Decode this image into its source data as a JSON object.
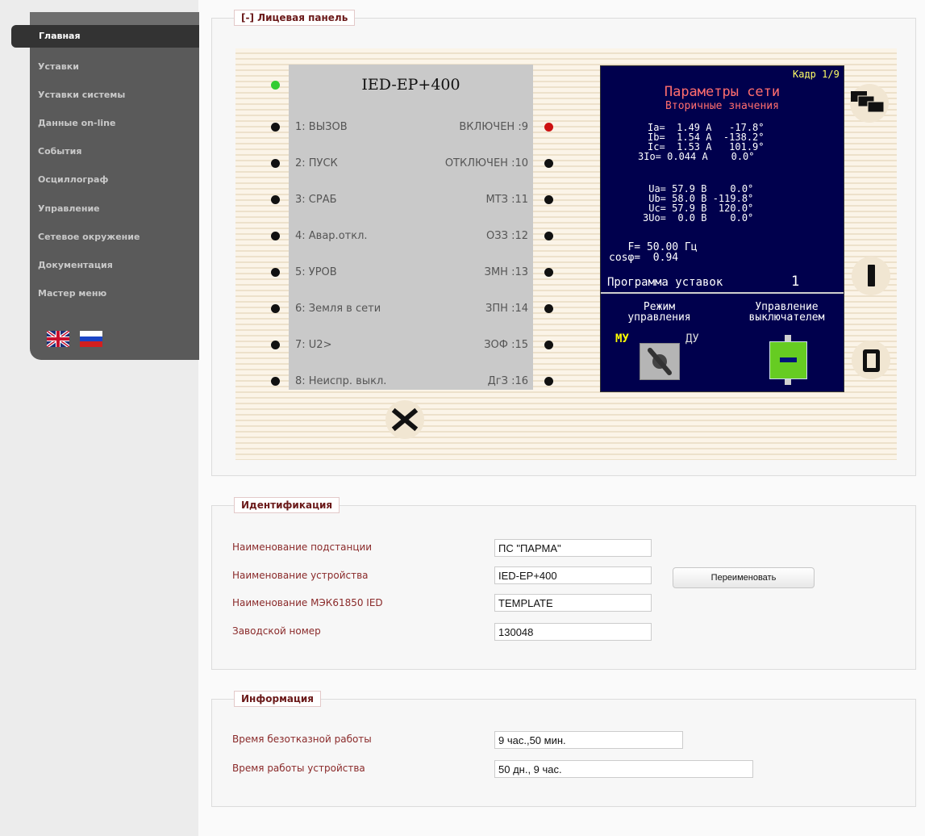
{
  "sidebar": {
    "items": [
      {
        "label": "Главная",
        "active": true
      },
      {
        "label": "Уставки"
      },
      {
        "label": "Уставки системы"
      },
      {
        "label": "Данные on-line"
      },
      {
        "label": "События"
      },
      {
        "label": "Осциллограф"
      },
      {
        "label": "Управление"
      },
      {
        "label": "Сетевое окружение"
      },
      {
        "label": "Документация"
      },
      {
        "label": "Мастер меню"
      }
    ],
    "languages": [
      "english-flag",
      "russian-flag"
    ]
  },
  "face_panel": {
    "legend": "[-] Лицевая панель",
    "device_title": "IED-EP+400",
    "left_leds": [
      "1: ВЫЗОВ",
      "2: ПУСК",
      "3: СРАБ",
      "4: Авар.откл.",
      "5: УРОВ",
      "6: Земля в сети",
      "7: U2>",
      "8: Неиспр. выкл."
    ],
    "right_leds": [
      "ВКЛЮЧЕН :9",
      "ОТКЛЮЧЕН :10",
      "МТЗ :11",
      "ОЗЗ :12",
      "ЗМН :13",
      "ЗПН :14",
      "ЗОФ :15",
      "ДгЗ :16"
    ],
    "colors": {
      "led_green": "#33cc33",
      "led_red": "#cc1111",
      "led_off": "#111111",
      "screen_bg": "#00004d",
      "title_red": "#ff6d6d",
      "mode_yellow": "#ffff00",
      "switch_green": "#66cc22"
    },
    "screen": {
      "frame": "Кадр 1/9",
      "title": "Параметры сети",
      "subtitle": "Вторичные значения",
      "currents": [
        "Ia=  1.49 A   -17.8°",
        "Ib=  1.54 A  -138.2°",
        "Ic=  1.53 A   101.9°",
        "3Io= 0.044 A    0.0°"
      ],
      "voltages": [
        " Ua= 57.9 B    0.0°",
        " Ub= 58.0 B -119.8°",
        " Uc= 57.9 B  120.0°",
        "3Uo=  0.0 B    0.0°"
      ],
      "freq": "   F= 50.00 Гц",
      "cos": "cosφ=  0.94",
      "program_label": "Программа уставок",
      "program_value": "1",
      "mode_label": "Режим\nуправления",
      "switch_label": "Управление\nвыключателем",
      "mode_local": "МУ",
      "mode_remote": "ДУ"
    },
    "buttons": {
      "close": "x",
      "one": "I",
      "zero": "O",
      "pages": "pages-icon"
    }
  },
  "identification": {
    "legend": "Идентификация",
    "rows": [
      {
        "label": "Наименование подстанции",
        "value": "ПС \"ПАРМА\""
      },
      {
        "label": "Наименование устройства",
        "value": "IED-EP+400"
      },
      {
        "label": "Наименование МЭК61850 IED",
        "value": "TEMPLATE"
      },
      {
        "label": "Заводской номер",
        "value": "130048"
      }
    ],
    "rename_button": "Переименовать"
  },
  "information": {
    "legend": "Информация",
    "rows": [
      {
        "label": "Время безотказной работы",
        "value": "9 час.,50 мин."
      },
      {
        "label": "Время работы устройства",
        "value": "50 дн., 9 час."
      }
    ]
  }
}
